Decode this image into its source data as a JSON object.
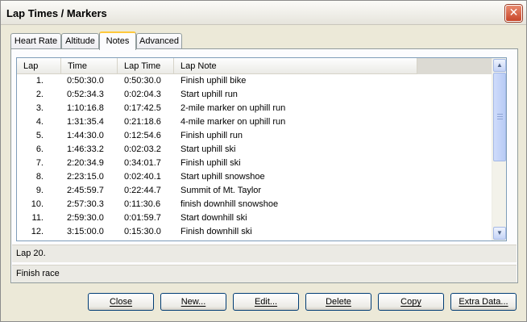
{
  "window": {
    "title": "Lap Times / Markers",
    "close_glyph": "✕"
  },
  "tabs": [
    {
      "label": "Heart Rate",
      "active": false
    },
    {
      "label": "Altitude",
      "active": false
    },
    {
      "label": "Notes",
      "active": true
    },
    {
      "label": "Advanced",
      "active": false
    }
  ],
  "table": {
    "columns": [
      "Lap",
      "Time",
      "Lap Time",
      "Lap Note"
    ],
    "rows": [
      {
        "lap": "1.",
        "time": "0:50:30.0",
        "lap_time": "0:50:30.0",
        "note": "Finish uphill bike"
      },
      {
        "lap": "2.",
        "time": "0:52:34.3",
        "lap_time": "0:02:04.3",
        "note": "Start uphill run"
      },
      {
        "lap": "3.",
        "time": "1:10:16.8",
        "lap_time": "0:17:42.5",
        "note": "2-mile marker on uphill run"
      },
      {
        "lap": "4.",
        "time": "1:31:35.4",
        "lap_time": "0:21:18.6",
        "note": "4-mile marker on uphill run"
      },
      {
        "lap": "5.",
        "time": "1:44:30.0",
        "lap_time": "0:12:54.6",
        "note": "Finish uphill run"
      },
      {
        "lap": "6.",
        "time": "1:46:33.2",
        "lap_time": "0:02:03.2",
        "note": "Start uphill ski"
      },
      {
        "lap": "7.",
        "time": "2:20:34.9",
        "lap_time": "0:34:01.7",
        "note": "Finish uphill ski"
      },
      {
        "lap": "8.",
        "time": "2:23:15.0",
        "lap_time": "0:02:40.1",
        "note": "Start uphill snowshoe"
      },
      {
        "lap": "9.",
        "time": "2:45:59.7",
        "lap_time": "0:22:44.7",
        "note": "Summit of Mt. Taylor"
      },
      {
        "lap": "10.",
        "time": "2:57:30.3",
        "lap_time": "0:11:30.6",
        "note": "finish downhill snowshoe"
      },
      {
        "lap": "11.",
        "time": "2:59:30.0",
        "lap_time": "0:01:59.7",
        "note": "Start downhill ski"
      },
      {
        "lap": "12.",
        "time": "3:15:00.0",
        "lap_time": "0:15:30.0",
        "note": "Finish downhill ski"
      }
    ]
  },
  "scrollbar": {
    "up_icon": "▲",
    "down_icon": "▼"
  },
  "status": {
    "selected_lap": "Lap 20.",
    "selected_note": "Finish race"
  },
  "buttons": {
    "close": "Close",
    "new": "New...",
    "edit": "Edit...",
    "delete": "Delete",
    "copy": "Copy",
    "extra_data": "Extra Data..."
  },
  "colors": {
    "window_bg": "#ece9d8",
    "panel_bg": "#fcfcfe",
    "active_tab_accent": "#ffc83c",
    "close_button": "#c8462a",
    "button_border": "#003c74",
    "listview_border": "#7f9db9"
  }
}
